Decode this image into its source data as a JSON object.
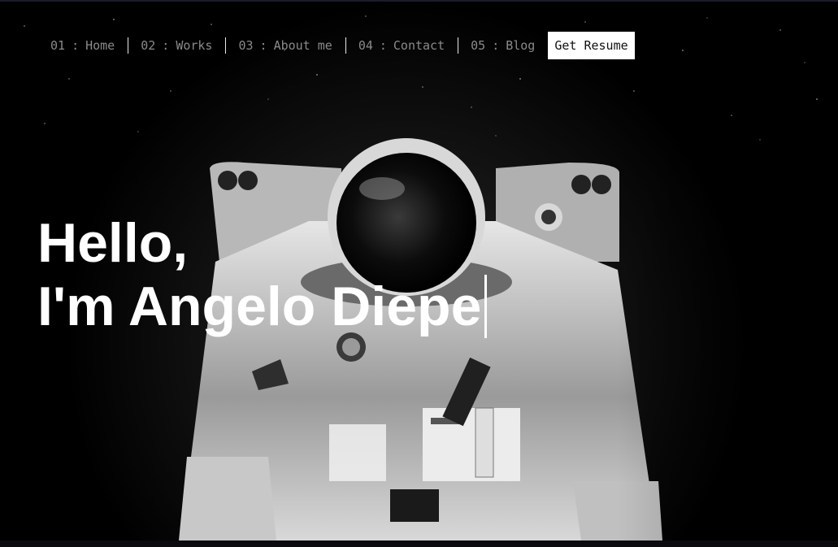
{
  "nav": {
    "items": [
      {
        "num": "01",
        "sep": ":",
        "label": "Home"
      },
      {
        "num": "02",
        "sep": ":",
        "label": "Works"
      },
      {
        "num": "03",
        "sep": ":",
        "label": "About me"
      },
      {
        "num": "04",
        "sep": ":",
        "label": "Contact"
      },
      {
        "num": "05",
        "sep": ":",
        "label": "Blog"
      }
    ],
    "resume_label": "Get Resume"
  },
  "hero": {
    "line1": "Hello,",
    "line2": "I'm Angelo Diepe",
    "image_icon": "astronaut-photo"
  },
  "colors": {
    "background": "#000000",
    "text": "#ffffff",
    "nav_text": "#8a8a8a",
    "button_bg": "#ffffff"
  }
}
